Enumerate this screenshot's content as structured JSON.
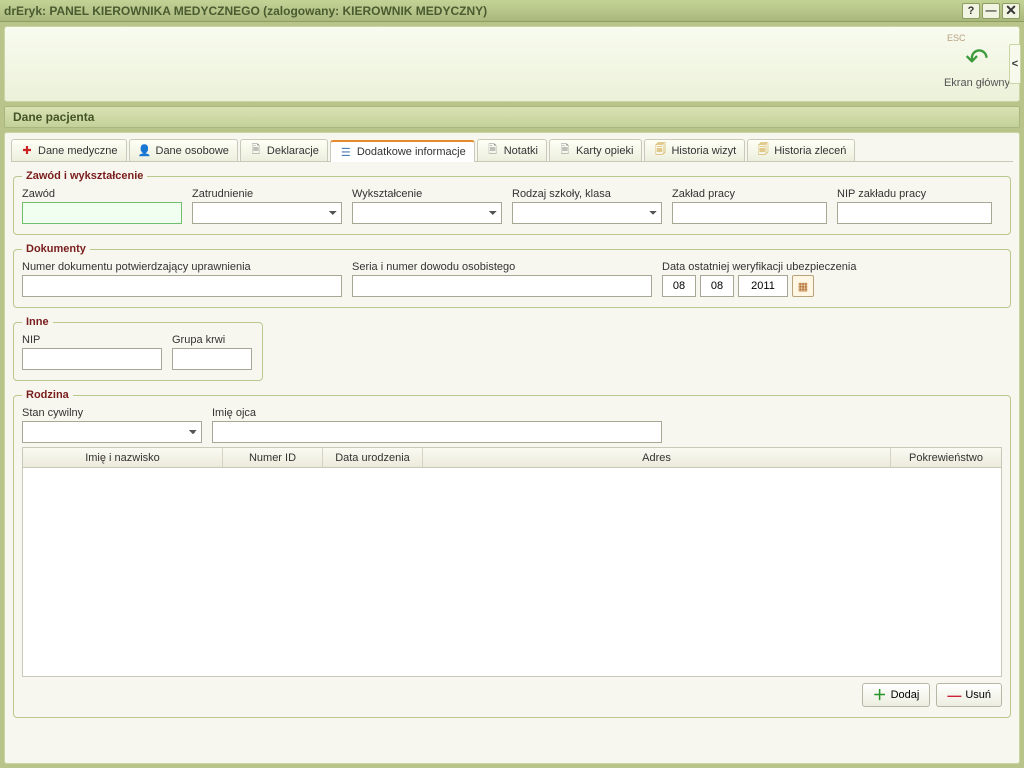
{
  "window": {
    "title": "drEryk: PANEL KIEROWNIKA MEDYCZNEGO (zalogowany: KIEROWNIK MEDYCZNY)"
  },
  "toolbar": {
    "esc_label": "ESC",
    "main_screen_label": "Ekran główny"
  },
  "subheader": {
    "title": "Dane pacjenta"
  },
  "tabs": {
    "items": [
      {
        "label": "Dane medyczne"
      },
      {
        "label": "Dane osobowe"
      },
      {
        "label": "Deklaracje"
      },
      {
        "label": "Dodatkowe informacje"
      },
      {
        "label": "Notatki"
      },
      {
        "label": "Karty opieki"
      },
      {
        "label": "Historia wizyt"
      },
      {
        "label": "Historia zleceń"
      }
    ]
  },
  "groups": {
    "zawod": {
      "legend": "Zawód i wykształcenie",
      "fields": {
        "zawod": "Zawód",
        "zatrudnienie": "Zatrudnienie",
        "wyksztalcenie": "Wykształcenie",
        "rodzaj_szkoly": "Rodzaj szkoły, klasa",
        "zaklad_pracy": "Zakład pracy",
        "nip_zakladu": "NIP zakładu pracy"
      }
    },
    "dokumenty": {
      "legend": "Dokumenty",
      "fields": {
        "numer_dok": "Numer dokumentu potwierdzający uprawnienia",
        "seria_dowod": "Seria i numer dowodu osobistego",
        "data_weryf": "Data ostatniej weryfikacji ubezpieczenia"
      },
      "date": {
        "day": "08",
        "month": "08",
        "year": "2011"
      }
    },
    "inne": {
      "legend": "Inne",
      "fields": {
        "nip": "NIP",
        "grupa_krwi": "Grupa krwi"
      }
    },
    "rodzina": {
      "legend": "Rodzina",
      "fields": {
        "stan_cywilny": "Stan cywilny",
        "imie_ojca": "Imię ojca"
      },
      "table_headers": {
        "imie_nazwisko": "Imię i nazwisko",
        "numer_id": "Numer ID",
        "data_urodzenia": "Data urodzenia",
        "adres": "Adres",
        "pokrewienstwo": "Pokrewieństwo"
      }
    }
  },
  "buttons": {
    "dodaj": "Dodaj",
    "usun": "Usuń"
  }
}
